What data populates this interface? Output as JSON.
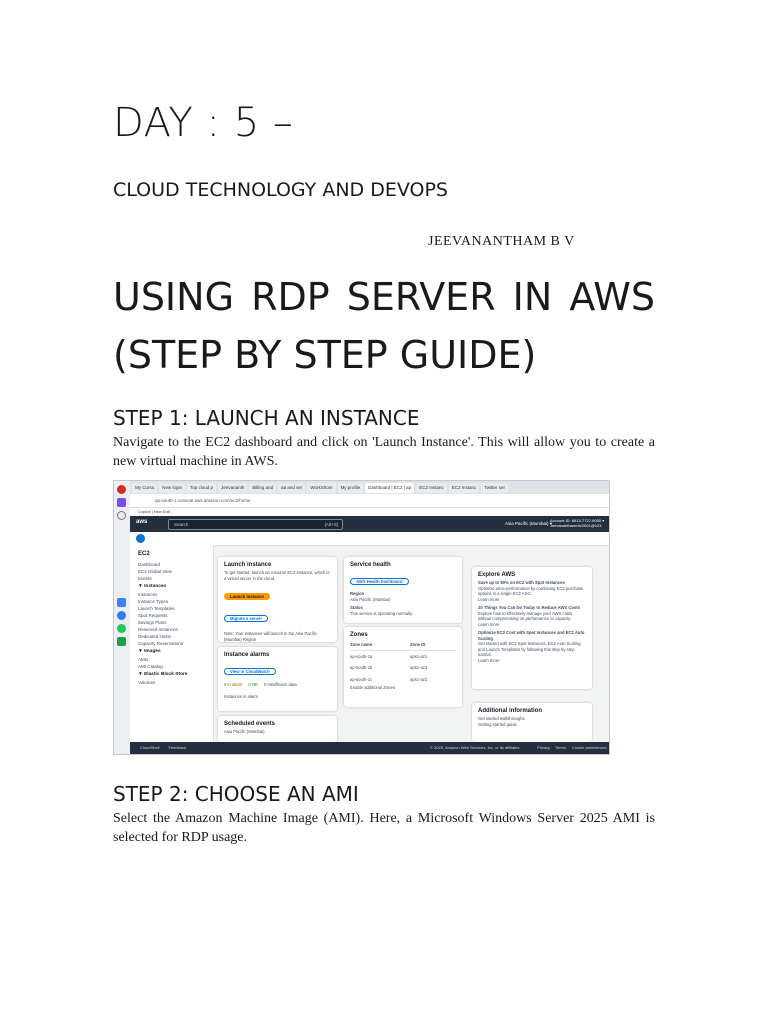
{
  "doc": {
    "title": "DAY : 5 –",
    "subtitle": "CLOUD TECHNOLOGY AND DEVOPS",
    "author": "JEEVANANTHAM B V",
    "heading_line1_words": [
      "USING",
      "RDP",
      "SERVER",
      "IN",
      "AWS"
    ],
    "heading_line2": "(STEP BY STEP GUIDE)",
    "step1": {
      "title": "STEP 1: LAUNCH AN INSTANCE",
      "text": "Navigate to the EC2 dashboard and click on 'Launch Instance'. This will allow you to create a new virtual machine in AWS."
    },
    "step2": {
      "title": "STEP 2: CHOOSE AN AMI",
      "text": "Select the Amazon Machine Image (AMI). Here, a Microsoft Windows Server 2025 AMI is selected for RDP usage."
    }
  },
  "screenshot": {
    "tabs": [
      "My Cursu",
      "New login",
      "Top cloud p",
      "Jeevananth",
      "Billing and",
      "aa and ser",
      "WorkShom",
      "My profile",
      "Dashboard | EC2 | ap",
      "EC2 Instanc",
      "EC2 Instanc",
      "Twitter ser"
    ],
    "url": "ap-south-1.console.aws.amazon.com/ec2/home",
    "bookmark": "Copilot | New Edit...",
    "search_placeholder": "Search",
    "search_shortcut": "[Alt+S]",
    "region": "Asia Pacific (Mumbai) ▾",
    "account_line1": "Account ID: 8913-7727-6000 ▾",
    "account_line2": "Jeevananthamrbv2001@123",
    "nav": {
      "title": "EC2",
      "items_top": [
        "Dashboard",
        "EC2 Global View",
        "Events"
      ],
      "group_instances": "▼ Instances",
      "items_instances": [
        "Instances",
        "Instance Types",
        "Launch Templates",
        "Spot Requests",
        "Savings Plans",
        "Reserved Instances",
        "Dedicated Hosts",
        "Capacity Reservations"
      ],
      "group_images": "▼ Images",
      "items_images": [
        "AMIs",
        "AMI Catalog"
      ],
      "group_ebs": "▼ Elastic Block Store",
      "items_ebs": [
        "Volumes"
      ]
    },
    "launch": {
      "title": "Launch instance",
      "desc": "To get started, launch an Amazon EC2 instance, which is a virtual server in the cloud.",
      "button": "Launch instance",
      "migrate": "Migrate a server",
      "note": "Note: Your instances will launch in the Asia Pacific (Mumbai) Region"
    },
    "alarms": {
      "title": "Instance alarms",
      "button": "View in CloudWatch",
      "in_alarm": "0 in alarm",
      "ok": "0 OK",
      "insufficient": "0 Insufficient data",
      "link": "Instances in alarm"
    },
    "scheduled": {
      "title": "Scheduled events",
      "region": "Asia Pacific (Mumbai)"
    },
    "health": {
      "title": "Service health",
      "button": "AWS Health Dashboard",
      "region_label": "Region",
      "region_value": "Asia Pacific (Mumbai)",
      "status_label": "Status",
      "status_value": "This service is operating normally."
    },
    "zones": {
      "title": "Zones",
      "col1": "Zone name",
      "col2": "Zone ID",
      "rows": [
        [
          "ap-south-1a",
          "aps1-az1"
        ],
        [
          "ap-south-1b",
          "aps1-az3"
        ],
        [
          "ap-south-1c",
          "aps1-az2"
        ]
      ],
      "link": "Enable additional Zones"
    },
    "explore": {
      "title": "Explore AWS",
      "items": [
        {
          "h": "Save up to 90% on EC2 with Spot Instances",
          "t": "Optimize price-performance by combining EC2 purchase options in a single EC2 ASG.",
          "l": "Learn more"
        },
        {
          "h": "10 Things You Can Do Today to Reduce AWS Costs",
          "t": "Explore how to effectively manage your AWS costs without compromising on performance or capacity.",
          "l": "Learn more"
        },
        {
          "h": "Optimize EC2 Cost with Spot Instances and EC2 Auto Scaling",
          "t": "Get started with EC2 Spot Instances, EC2 Auto Scaling, and Launch Templates by following this step by step tutorial.",
          "l": "Learn more"
        }
      ]
    },
    "additional": {
      "title": "Additional information",
      "links": [
        "Get started walkthroughs",
        "Getting started guide"
      ]
    },
    "footer": {
      "cloudshell": "CloudShell",
      "feedback": "Feedback",
      "copyright": "© 2025, Amazon Web Services, Inc. or its affiliates.",
      "privacy": "Privacy",
      "terms": "Terms",
      "cookie": "Cookie preferences"
    },
    "colors": {
      "aws_nav": "#232f3e",
      "aws_orange": "#ff9900",
      "aws_blue": "#0972d3",
      "status_green": "#037f0c"
    }
  }
}
